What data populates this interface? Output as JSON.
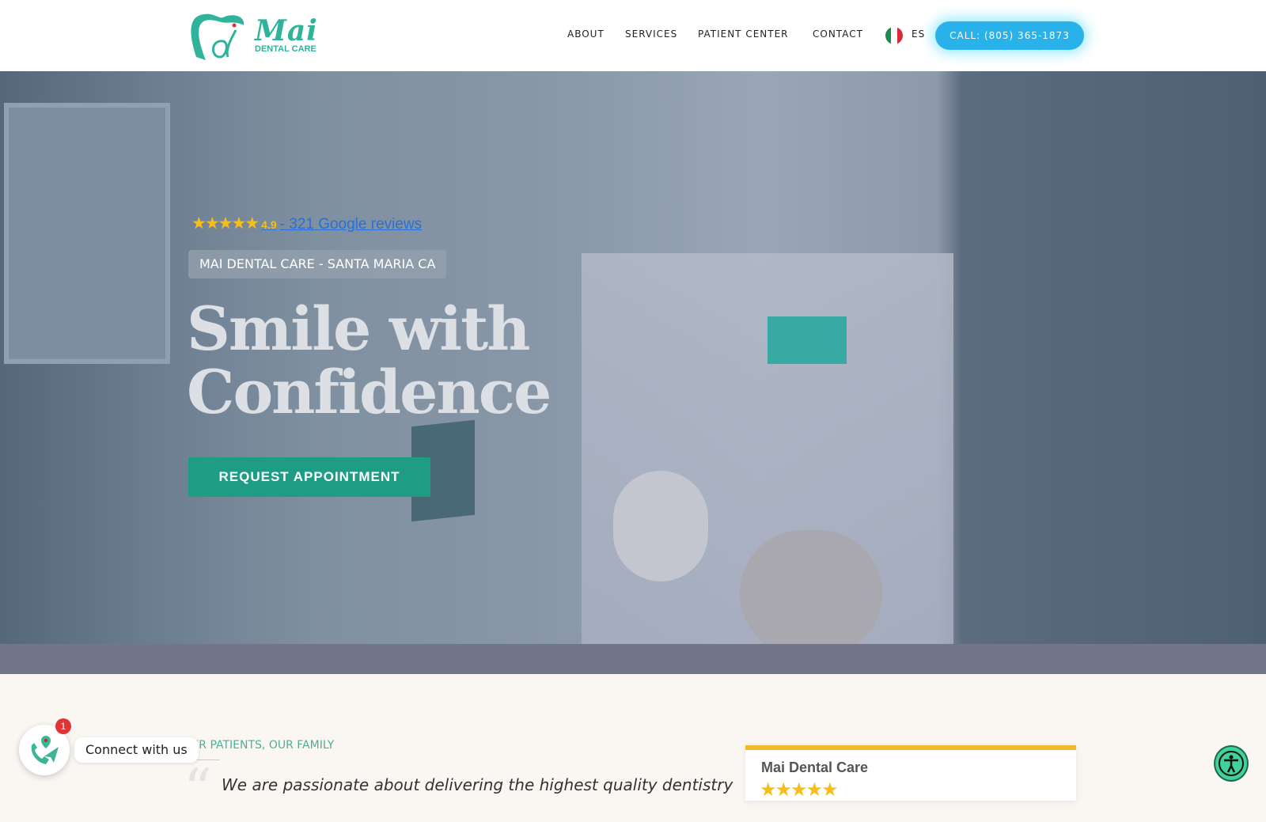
{
  "header": {
    "logo": {
      "name": "Mai",
      "subtitle": "DENTAL CARE"
    },
    "nav": [
      "ABOUT",
      "SERVICES",
      "PATIENT CENTER",
      "CONTACT"
    ],
    "language": "ES",
    "call_label": "CALL: (805) 365-1873"
  },
  "hero": {
    "stars": "★★★★★",
    "rating": "4.9",
    "reviews_link": "- 321 Google reviews",
    "location_tag": "MAI DENTAL CARE - SANTA MARIA CA",
    "title_line1": "Smile with",
    "title_line2": "Confidence",
    "cta": "REQUEST APPOINTMENT"
  },
  "about": {
    "kicker": "OUR PATIENTS, OUR FAMILY",
    "quote_mark": "“",
    "quote": "We are passionate about delivering the highest quality dentistry"
  },
  "review_card": {
    "title": "Mai Dental Care",
    "stars": "★★★★★"
  },
  "widget": {
    "label": "Connect with us",
    "badge": "1"
  },
  "colors": {
    "brand": "#2fb39a",
    "call_button": "#29b2ea",
    "cta": "#1f9c84",
    "star": "#f6be1d",
    "accessibility": "#43d19b"
  }
}
